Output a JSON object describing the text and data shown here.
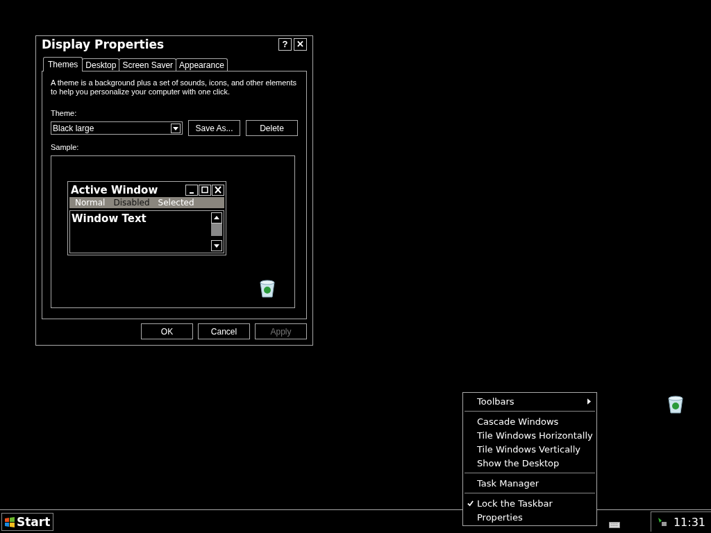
{
  "dialog": {
    "title": "Display Properties",
    "help": "?",
    "close": "✕",
    "tabs": [
      {
        "label": "Themes",
        "selected": true
      },
      {
        "label": "Desktop",
        "selected": false
      },
      {
        "label": "Screen Saver",
        "selected": false
      },
      {
        "label": "Appearance",
        "selected": false
      }
    ],
    "description": "A theme is a background plus a set of sounds, icons, and other elements to help you personalize your computer with one click.",
    "theme_label": "Theme:",
    "theme_value": "Black large",
    "save_as": "Save As...",
    "delete": "Delete",
    "sample_label": "Sample:",
    "sample": {
      "title": "Active Window",
      "menu": [
        {
          "label": "Normal",
          "kind": "normal"
        },
        {
          "label": "Disabled",
          "kind": "disabled"
        },
        {
          "label": "Selected",
          "kind": "selected"
        }
      ],
      "window_text": "Window Text"
    },
    "buttons": [
      {
        "label": "OK",
        "disabled": false
      },
      {
        "label": "Cancel",
        "disabled": false
      },
      {
        "label": "Apply",
        "disabled": true
      }
    ]
  },
  "context_menu": [
    {
      "kind": "item",
      "label": "Toolbars",
      "submenu": true,
      "checked": false
    },
    {
      "kind": "separator"
    },
    {
      "kind": "item",
      "label": "Cascade Windows",
      "submenu": false,
      "checked": false
    },
    {
      "kind": "item",
      "label": "Tile Windows Horizontally",
      "submenu": false,
      "checked": false
    },
    {
      "kind": "item",
      "label": "Tile Windows Vertically",
      "submenu": false,
      "checked": false
    },
    {
      "kind": "item",
      "label": "Show the Desktop",
      "submenu": false,
      "checked": false
    },
    {
      "kind": "separator"
    },
    {
      "kind": "item",
      "label": "Task Manager",
      "submenu": false,
      "checked": false
    },
    {
      "kind": "separator"
    },
    {
      "kind": "item",
      "label": "Lock the Taskbar",
      "submenu": false,
      "checked": true
    },
    {
      "kind": "item",
      "label": "Properties",
      "submenu": false,
      "checked": false
    }
  ],
  "taskbar": {
    "start": "Start",
    "clock": "11:31"
  }
}
